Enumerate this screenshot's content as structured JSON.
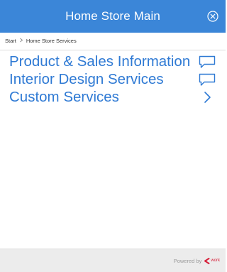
{
  "header": {
    "title": "Home Store Main",
    "close_icon": "close-circle-icon",
    "background_color": "#3b86d8"
  },
  "breadcrumb": {
    "items": [
      "Start",
      "Home Store Services"
    ],
    "separator_icon": "chevron-right-icon"
  },
  "menu": {
    "accent_color": "#2f7ad4",
    "items": [
      {
        "label": "Product & Sales Information",
        "icon": "chat-bubble-icon"
      },
      {
        "label": "Interior Design Services",
        "icon": "chat-bubble-icon"
      },
      {
        "label": "Custom Services",
        "icon": "chevron-right-icon"
      }
    ]
  },
  "footer": {
    "powered_by": "Powered by",
    "brand_icon": "brand-logo-icon",
    "brand_text": "work",
    "brand_color": "#d6203a"
  }
}
